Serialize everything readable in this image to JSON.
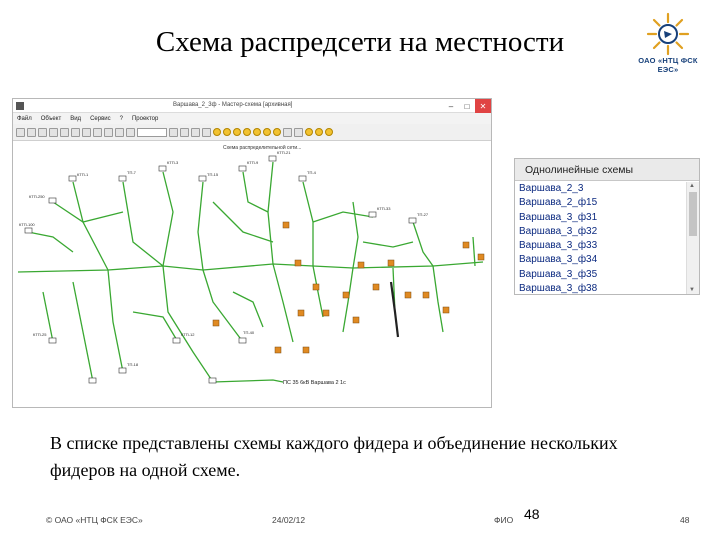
{
  "slide": {
    "title": "Схема распредсети на местности",
    "body_text": "В списке представлены схемы каждого фидера и объединение нескольких фидеров на одной схеме.",
    "logo_caption": "ОАО «НТЦ ФСК ЕЭС»"
  },
  "app_window": {
    "title": "Варшава_2_3ф - Мастер-схема [архивная]",
    "menu": [
      "Файл",
      "Объект",
      "Вид",
      "Сервис",
      "?",
      "Проектор"
    ],
    "canvas_caption": "Схема распределительной сети...",
    "ps_label": "ПС 35 6кВ Варшава 2 1с"
  },
  "list_panel": {
    "header": "Однолинейные схемы",
    "items": [
      "Варшава_2_3",
      "Варшава_2_ф15",
      "Варшава_3_ф31",
      "Варшава_3_ф32",
      "Варшава_3_ф33",
      "Варшава_3_ф34",
      "Варшава_3_ф35",
      "Варшава_3_ф38"
    ]
  },
  "footer": {
    "company": "© ОАО «НТЦ ФСК ЕЭС»",
    "date": "24/02/12",
    "fio": "ФИО",
    "slide_number_center": "48",
    "slide_number_right": "48"
  },
  "colors": {
    "line_green": "#3aa832",
    "node_orange": "#e08a22",
    "list_text": "#0c2a80",
    "logo_blue": "#17407a",
    "logo_gold": "#e0a020"
  }
}
